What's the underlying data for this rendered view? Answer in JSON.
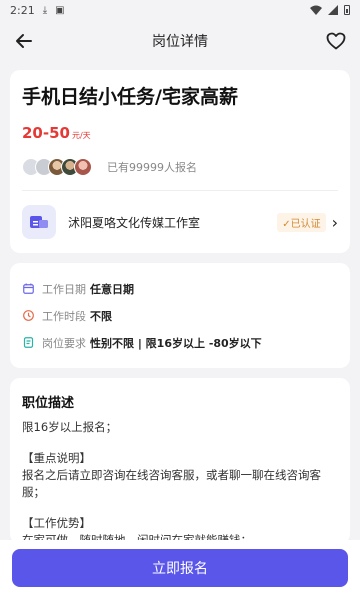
{
  "status_bar": {
    "time": "2:21"
  },
  "header": {
    "title": "岗位详情",
    "back_icon": "arrow-left-icon",
    "favorite_icon": "heart-outline-icon"
  },
  "job": {
    "title": "手机日结小任务/宅家高薪",
    "salary_range": "20-50",
    "salary_unit": "元/天",
    "signup_text": "已有99999人报名"
  },
  "company": {
    "name": "沭阳夏咯文化传媒工作室",
    "verified_label": "✓已认证"
  },
  "info": [
    {
      "icon": "calendar-icon",
      "label": "工作日期",
      "value": "任意日期"
    },
    {
      "icon": "clock-icon",
      "label": "工作时段",
      "value": "不限"
    },
    {
      "icon": "requirement-icon",
      "label": "岗位要求",
      "value": "性别不限 | 限16岁以上 -80岁以下"
    }
  ],
  "description": {
    "title": "职位描述",
    "lines": [
      " 限16岁以上报名；",
      "",
      "【重点说明】",
      "报名之后请立即咨询在线咨询客服，或者聊一聊在线咨询客服；",
      "",
      "【工作优势】",
      "在家可做，随时随地，闲时间在家就能赚钱；"
    ]
  },
  "apply_button": "立即报名",
  "colors": {
    "accent": "#5a56e9",
    "salary": "#e53935",
    "verified": "#d28a35"
  }
}
